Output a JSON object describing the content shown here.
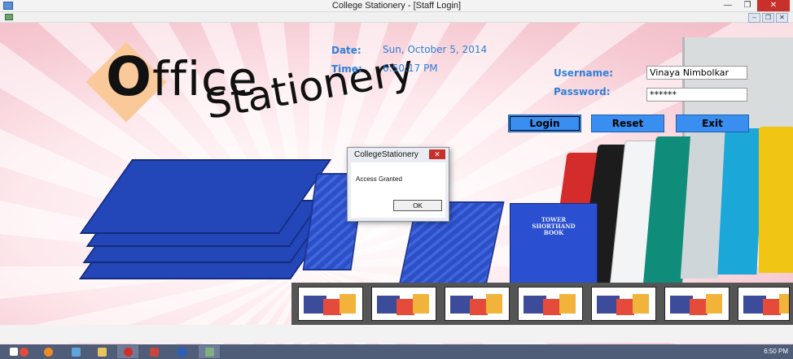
{
  "window": {
    "title": "College Stationery - [Staff Login]"
  },
  "logo": {
    "o_letter": "O",
    "office_rest": "ffice",
    "stationery": "Stationery"
  },
  "datetime": {
    "date_label": "Date:",
    "date_value": "Sun, October 5, 2014",
    "time_label": "Time:",
    "time_value": "6:50:17 PM"
  },
  "login": {
    "username_label": "Username:",
    "username_value": "Vinaya Nimbolkar",
    "password_label": "Password:",
    "password_value": "******",
    "login_button": "Login",
    "reset_button": "Reset",
    "exit_button": "Exit"
  },
  "products": {
    "book_brand": "TOWER",
    "book_title": "SHORTHAND",
    "book_subtitle": "BOOK"
  },
  "dialog": {
    "title": "CollegeStationery",
    "close": "✕",
    "message": "Access Granted",
    "ok_button": "OK"
  },
  "taskbar": {
    "apps": [
      "chrome-icon",
      "firefox-icon",
      "computer-icon",
      "folder-icon",
      "opera-icon",
      "tools-icon",
      "word-icon",
      "app-icon"
    ],
    "clock": "6:50 PM"
  },
  "colors": {
    "accent": "#3a8ef0",
    "label_blue": "#2f7fd8"
  }
}
